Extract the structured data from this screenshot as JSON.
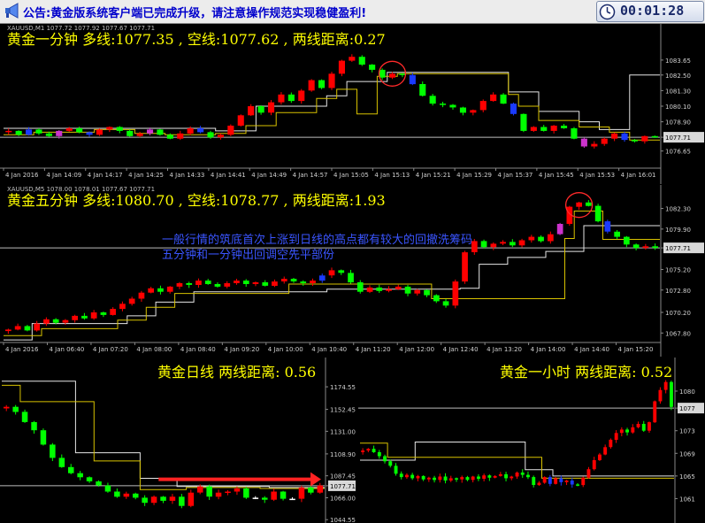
{
  "banner": {
    "text": "公告:黄金版系统客户端已完成升级，请注意操作规范实现稳健盈利!",
    "clock": "00:01:28"
  },
  "colors": {
    "up": "#FF0000",
    "down": "#00FF00",
    "doji": "#FFFFFF",
    "blue_bar": "#1a3aff",
    "magenta_bar": "#cc33cc",
    "line_yellow": "#d8c200",
    "line_white": "#e6e6e6",
    "price_line": "#bcbcbc",
    "grid_axis": "#888888",
    "circle": "#ff2a2a"
  },
  "panels": [
    {
      "id": "m1",
      "symbol_info": "XAUUSD,M1  1077.72 1077.92 1077.67 1077.71",
      "title": "黄金一分钟  多线:1077.35 ,   空线:1077.62 ,   两线距离:0.27",
      "note": [],
      "current_price": "1077.71",
      "chart_data": {
        "type": "candlestick",
        "ylim": [
          1075.4,
          1084.8
        ],
        "y_ticks": [
          "1083.65",
          "1082.50",
          "1081.30",
          "1080.10",
          "1078.90",
          "1077.71",
          "1076.65"
        ],
        "x_labels": [
          "4 Jan 2016",
          "4 Jan 14:09",
          "4 Jan 14:17",
          "4 Jan 14:25",
          "4 Jan 14:33",
          "4 Jan 14:41",
          "4 Jan 14:49",
          "4 Jan 14:57",
          "4 Jan 15:05",
          "4 Jan 15:13",
          "4 Jan 15:21",
          "4 Jan 15:29",
          "4 Jan 15:37",
          "4 Jan 15:45",
          "4 Jan 15:53",
          "4 Jan 16:01"
        ],
        "path": [
          1078.2,
          1077.9,
          1078.3,
          1078.0,
          1077.8,
          1078.2,
          1078.4,
          1078.1,
          1077.9,
          1078.3,
          1078.5,
          1078.2,
          1077.8,
          1078.0,
          1078.3,
          1077.9,
          1077.6,
          1078.0,
          1078.4,
          1078.1,
          1077.7,
          1077.9,
          1078.6,
          1079.4,
          1080.1,
          1079.6,
          1080.4,
          1081.0,
          1080.5,
          1081.3,
          1082.1,
          1081.5,
          1082.6,
          1083.6,
          1083.9,
          1083.3,
          1082.9,
          1082.3,
          1082.6,
          1082.5,
          1081.8,
          1080.9,
          1080.3,
          1080.2,
          1080.0,
          1079.6,
          1079.8,
          1080.5,
          1081.0,
          1080.3,
          1079.5,
          1078.2,
          1078.5,
          1078.2,
          1078.6,
          1078.4,
          1077.6,
          1077.0,
          1077.2,
          1077.6,
          1078.0,
          1077.5,
          1077.4,
          1077.8,
          1077.7
        ],
        "markers": {
          "blue": [
            2,
            8,
            19,
            40,
            50,
            61
          ],
          "magenta": [
            5,
            14,
            57
          ]
        },
        "yellow_line": [
          1077.9,
          1077.9,
          1077.9,
          1078.1,
          1078.1,
          1078.1,
          1078.1,
          1078.1,
          1078.1,
          1078.3,
          1078.3,
          1078.3,
          1078.3,
          1078.0,
          1078.0,
          1078.0,
          1077.9,
          1077.9,
          1077.9,
          1077.9,
          1077.9,
          1078.0,
          1078.0,
          1078.0,
          1078.6,
          1078.6,
          1078.6,
          1079.6,
          1079.6,
          1079.6,
          1079.6,
          1080.7,
          1080.7,
          1081.4,
          1081.4,
          1079.5,
          1079.5,
          1082.4,
          1082.4,
          1082.6,
          1082.6,
          1082.6,
          1082.6,
          1082.6,
          1082.6,
          1082.6,
          1082.6,
          1082.6,
          1082.6,
          1082.6,
          1081.0,
          1080.1,
          1080.1,
          1079.0,
          1079.0,
          1079.0,
          1079.0,
          1078.5,
          1078.5,
          1078.5,
          1078.1,
          1078.1,
          1077.5,
          1077.5,
          1077.5
        ],
        "white_line": [
          1078.4,
          1078.4,
          1078.4,
          1078.4,
          1078.4,
          1078.4,
          1078.4,
          1078.4,
          1078.4,
          1078.4,
          1078.4,
          1078.4,
          1078.4,
          1078.4,
          1078.4,
          1078.4,
          1078.4,
          1078.4,
          1078.4,
          1078.4,
          1078.4,
          1078.2,
          1078.2,
          1078.2,
          1078.2,
          1080.1,
          1080.1,
          1080.1,
          1080.1,
          1080.1,
          1080.1,
          1080.1,
          1080.9,
          1080.9,
          1082.0,
          1082.0,
          1082.0,
          1082.0,
          1082.7,
          1082.7,
          1082.7,
          1082.7,
          1082.7,
          1082.7,
          1082.7,
          1082.7,
          1082.7,
          1082.7,
          1082.7,
          1082.7,
          1081.2,
          1081.2,
          1081.2,
          1079.7,
          1079.7,
          1079.7,
          1079.7,
          1078.9,
          1078.9,
          1078.3,
          1078.3,
          1078.3,
          1082.5,
          1082.5,
          1082.5
        ],
        "circle": {
          "index": 38,
          "price": 1082.6
        }
      }
    },
    {
      "id": "m5",
      "symbol_info": "XAUUSD,M5  1078.00 1078.01 1077.67 1077.71",
      "title": "黄金五分钟  多线:1080.70 ,   空线:1078.77 ,   两线距离:1.93",
      "note": [
        "一般行情的筑底首次上涨到日线的高点都有较大的回撤洗筹码",
        "五分钟和一分钟出回调空先平部份"
      ],
      "current_price": "1077.71",
      "chart_data": {
        "type": "candlestick",
        "ylim": [
          1066.8,
          1083.8
        ],
        "y_ticks": [
          "1082.30",
          "1079.90",
          "1077.71",
          "1075.20",
          "1072.80",
          "1070.20",
          "1067.80"
        ],
        "x_labels": [
          "4 Jan 2016",
          "4 Jan 06:40",
          "4 Jan 07:20",
          "4 Jan 08:00",
          "4 Jan 08:40",
          "4 Jan 09:20",
          "4 Jan 10:00",
          "4 Jan 10:40",
          "4 Jan 11:20",
          "4 Jan 12:00",
          "4 Jan 12:40",
          "4 Jan 13:20",
          "4 Jan 14:00",
          "4 Jan 14:40",
          "4 Jan 15:20"
        ],
        "path": [
          1068.2,
          1068.6,
          1068.1,
          1068.9,
          1069.4,
          1069.0,
          1069.3,
          1069.8,
          1069.5,
          1070.2,
          1069.9,
          1070.6,
          1071.2,
          1071.8,
          1072.5,
          1073.0,
          1072.6,
          1073.2,
          1073.6,
          1073.4,
          1073.9,
          1073.5,
          1073.2,
          1073.6,
          1073.9,
          1073.5,
          1073.7,
          1073.3,
          1073.8,
          1074.1,
          1073.8,
          1073.6,
          1073.9,
          1074.5,
          1075.1,
          1074.8,
          1073.7,
          1072.6,
          1073.1,
          1072.7,
          1072.9,
          1073.2,
          1072.4,
          1072.8,
          1072.2,
          1071.5,
          1071.0,
          1073.8,
          1077.2,
          1078.5,
          1077.8,
          1078.2,
          1078.4,
          1078.0,
          1078.6,
          1079.0,
          1078.5,
          1079.3,
          1080.5,
          1082.5,
          1083.0,
          1082.6,
          1080.8,
          1079.6,
          1079.0,
          1078.1,
          1077.7,
          1077.9,
          1077.71
        ],
        "markers": {
          "blue": [
            33,
            63
          ],
          "magenta": [
            58
          ]
        },
        "yellow_line": [
          1067.5,
          1067.5,
          1067.5,
          1067.5,
          1068.3,
          1068.3,
          1068.3,
          1068.3,
          1068.3,
          1068.3,
          1068.3,
          1068.3,
          1069.3,
          1069.3,
          1069.3,
          1070.8,
          1070.8,
          1070.8,
          1072.4,
          1072.4,
          1072.4,
          1072.4,
          1072.4,
          1072.4,
          1072.4,
          1072.4,
          1072.4,
          1072.4,
          1072.4,
          1072.4,
          1073.5,
          1073.5,
          1073.5,
          1073.5,
          1073.5,
          1073.5,
          1073.5,
          1073.5,
          1073.5,
          1073.5,
          1073.5,
          1073.5,
          1073.5,
          1073.5,
          1073.5,
          1071.8,
          1071.8,
          1071.8,
          1071.8,
          1071.8,
          1071.8,
          1071.8,
          1071.8,
          1071.8,
          1071.8,
          1071.8,
          1071.8,
          1071.8,
          1071.8,
          1078.8,
          1082.0,
          1082.0,
          1082.0,
          1078.7,
          1078.7,
          1078.7,
          1078.7,
          1078.7,
          1078.7
        ],
        "white_line": [
          1067.0,
          1067.0,
          1067.0,
          1068.9,
          1068.9,
          1068.9,
          1068.9,
          1068.9,
          1068.9,
          1068.9,
          1068.9,
          1068.9,
          1068.9,
          1069.8,
          1069.8,
          1069.8,
          1071.4,
          1071.4,
          1071.4,
          1071.4,
          1072.6,
          1072.6,
          1072.6,
          1072.6,
          1072.6,
          1072.6,
          1072.6,
          1072.6,
          1072.6,
          1072.6,
          1072.6,
          1072.6,
          1072.6,
          1072.6,
          1072.9,
          1072.9,
          1072.9,
          1072.9,
          1072.9,
          1072.9,
          1072.9,
          1072.9,
          1072.9,
          1072.9,
          1072.9,
          1072.9,
          1072.9,
          1072.9,
          1073.0,
          1073.0,
          1075.8,
          1075.8,
          1075.8,
          1076.6,
          1076.6,
          1076.6,
          1076.6,
          1077.3,
          1077.3,
          1077.3,
          1077.3,
          1080.3,
          1080.3,
          1080.3,
          1080.3,
          1080.3,
          1080.3,
          1080.3,
          1080.3
        ],
        "circle": {
          "index": 60,
          "price": 1082.7
        }
      }
    },
    {
      "id": "d1",
      "symbol_info": "",
      "title": "黄金日线   两线距离: 0.56",
      "note": [],
      "current_price": "1077.71",
      "chart_data": {
        "type": "candlestick",
        "ylim": [
          1043,
          1198
        ],
        "y_ticks": [
          "1174.55",
          "1152.45",
          "1131.00",
          "1108.90",
          "1087.45",
          "1077.71",
          "1066.00",
          "1044.55"
        ],
        "x_labels": [],
        "path": [
          1155,
          1150,
          1140,
          1132,
          1118,
          1105,
          1096,
          1090,
          1086,
          1082,
          1078,
          1072,
          1067,
          1070,
          1066,
          1061,
          1067,
          1063,
          1067,
          1058,
          1071,
          1077,
          1067,
          1071,
          1072,
          1075,
          1066,
          1066,
          1064,
          1072,
          1065,
          1065,
          1076,
          1071,
          1078
        ],
        "markers": {
          "blue": [],
          "magenta": []
        },
        "yellow_line": [
          1176,
          1176,
          1160,
          1160,
          1160,
          1160,
          1160,
          1160,
          1160,
          1160,
          1102,
          1102,
          1102,
          1102,
          1102,
          1074,
          1074,
          1074,
          1074,
          1074,
          1076,
          1076,
          1076,
          1076,
          1076,
          1076,
          1076,
          1076,
          1075,
          1075,
          1075,
          1075,
          1075,
          1075,
          1075
        ],
        "white_line": [
          1180,
          1180,
          1180,
          1180,
          1180,
          1180,
          1180,
          1180,
          1110,
          1110,
          1110,
          1110,
          1110,
          1110,
          1110,
          1085,
          1085,
          1085,
          1085,
          1077,
          1077,
          1077,
          1077,
          1077,
          1077,
          1077,
          1077,
          1077,
          1077,
          1076,
          1076,
          1076,
          1076,
          1076,
          1076
        ],
        "arrow": {
          "from_index": 17,
          "price": 1084
        }
      }
    },
    {
      "id": "h1",
      "symbol_info": "",
      "title": "黄金一小时   两线距离: 0.52",
      "note": [],
      "current_price": "1077",
      "chart_data": {
        "type": "candlestick",
        "ylim": [
          1057,
          1085
        ],
        "y_ticks": [
          "1080",
          "1077",
          "1073",
          "1069",
          "1065",
          "1061"
        ],
        "x_labels": [],
        "path": [
          1069.5,
          1069.8,
          1069.2,
          1068.5,
          1067.6,
          1066.8,
          1065.4,
          1064.8,
          1065.2,
          1064.6,
          1065.0,
          1064.4,
          1064.7,
          1064.3,
          1064.9,
          1064.2,
          1064.6,
          1064.4,
          1064.8,
          1064.3,
          1064.9,
          1064.5,
          1065.1,
          1064.7,
          1065.0,
          1065.3,
          1064.6,
          1064.9,
          1065.6,
          1065.2,
          1064.8,
          1063.4,
          1063.8,
          1064.8,
          1063.6,
          1064.6,
          1063.9,
          1064.2,
          1063.5,
          1063.4,
          1064.7,
          1066.2,
          1067.8,
          1068.8,
          1070.1,
          1071.4,
          1072.6,
          1073.2,
          1072.7,
          1073.6,
          1074.2,
          1073.0,
          1074.5,
          1078.2,
          1080.2,
          1081.6,
          1077.2
        ],
        "markers": {
          "blue": [
            34,
            36,
            38
          ],
          "magenta": []
        },
        "yellow_line": [
          1070.8,
          1070.8,
          1070.8,
          1070.8,
          1070.8,
          1068.3,
          1068.3,
          1068.3,
          1068.3,
          1068.3,
          1068.3,
          1068.3,
          1068.3,
          1068.3,
          1068.3,
          1068.3,
          1068.3,
          1068.3,
          1068.3,
          1068.3,
          1068.3,
          1068.3,
          1068.3,
          1068.3,
          1068.3,
          1068.3,
          1068.3,
          1068.3,
          1068.3,
          1068.3,
          1068.3,
          1068.3,
          1068.3,
          1064.6,
          1064.6,
          1064.6,
          1064.6,
          1064.6,
          1064.6,
          1064.6,
          1064.6,
          1064.6,
          1064.6,
          1064.6,
          1064.6,
          1064.6,
          1064.6,
          1064.6,
          1064.6,
          1064.6,
          1064.6,
          1064.6,
          1064.6,
          1064.6,
          1064.6,
          1064.6,
          1064.6
        ],
        "white_line": [
          1067.8,
          1067.8,
          1067.8,
          1067.8,
          1067.8,
          1067.8,
          1067.8,
          1067.8,
          1067.8,
          1067.8,
          1071.0,
          1071.0,
          1071.0,
          1071.0,
          1071.0,
          1071.0,
          1071.0,
          1071.0,
          1071.0,
          1071.0,
          1071.0,
          1071.0,
          1071.0,
          1071.0,
          1071.0,
          1071.0,
          1071.0,
          1071.0,
          1071.0,
          1071.0,
          1066.1,
          1066.1,
          1066.1,
          1066.1,
          1066.1,
          1065.0,
          1065.0,
          1065.0,
          1065.0,
          1065.0,
          1065.0,
          1065.0,
          1065.0,
          1065.0,
          1065.0,
          1065.0,
          1065.0,
          1065.0,
          1065.0,
          1065.0,
          1065.0,
          1065.0,
          1065.0,
          1065.0,
          1065.0,
          1065.0,
          1065.0
        ]
      }
    }
  ]
}
